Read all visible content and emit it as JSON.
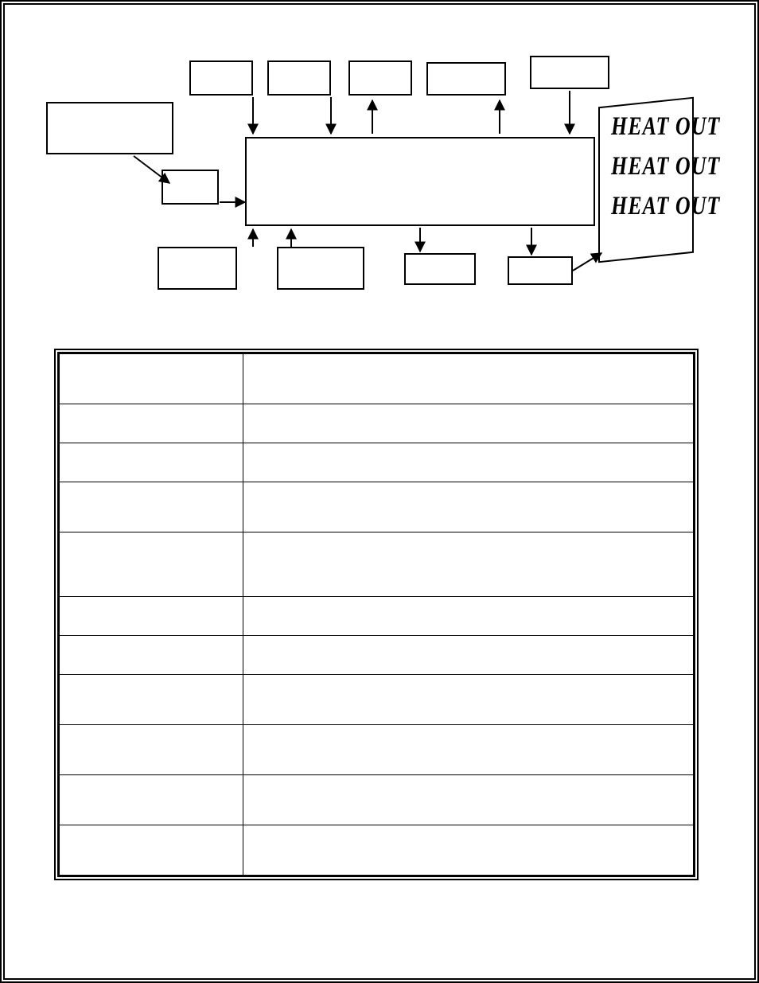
{
  "diagram": {
    "top_boxes": [
      {
        "id": "tb1"
      },
      {
        "id": "tb2"
      },
      {
        "id": "tb3"
      },
      {
        "id": "tb4"
      },
      {
        "id": "tb5"
      }
    ],
    "left_box": {
      "id": "lb"
    },
    "left_small_box": {
      "id": "lsb"
    },
    "main_box": {
      "id": "mb"
    },
    "bottom_boxes": [
      {
        "id": "bb1"
      },
      {
        "id": "bb2"
      },
      {
        "id": "bb3"
      },
      {
        "id": "bb4"
      }
    ],
    "heat_panel": {
      "lines": [
        "HEAT OUT",
        "HEAT OUT",
        "HEAT OUT"
      ]
    }
  },
  "table": {
    "rows": [
      {
        "h": "tall"
      },
      {
        "h": ""
      },
      {
        "h": ""
      },
      {
        "h": "tall"
      },
      {
        "h": "taller"
      },
      {
        "h": ""
      },
      {
        "h": ""
      },
      {
        "h": "tall"
      },
      {
        "h": "tall"
      },
      {
        "h": "tall"
      },
      {
        "h": "tall"
      }
    ]
  }
}
